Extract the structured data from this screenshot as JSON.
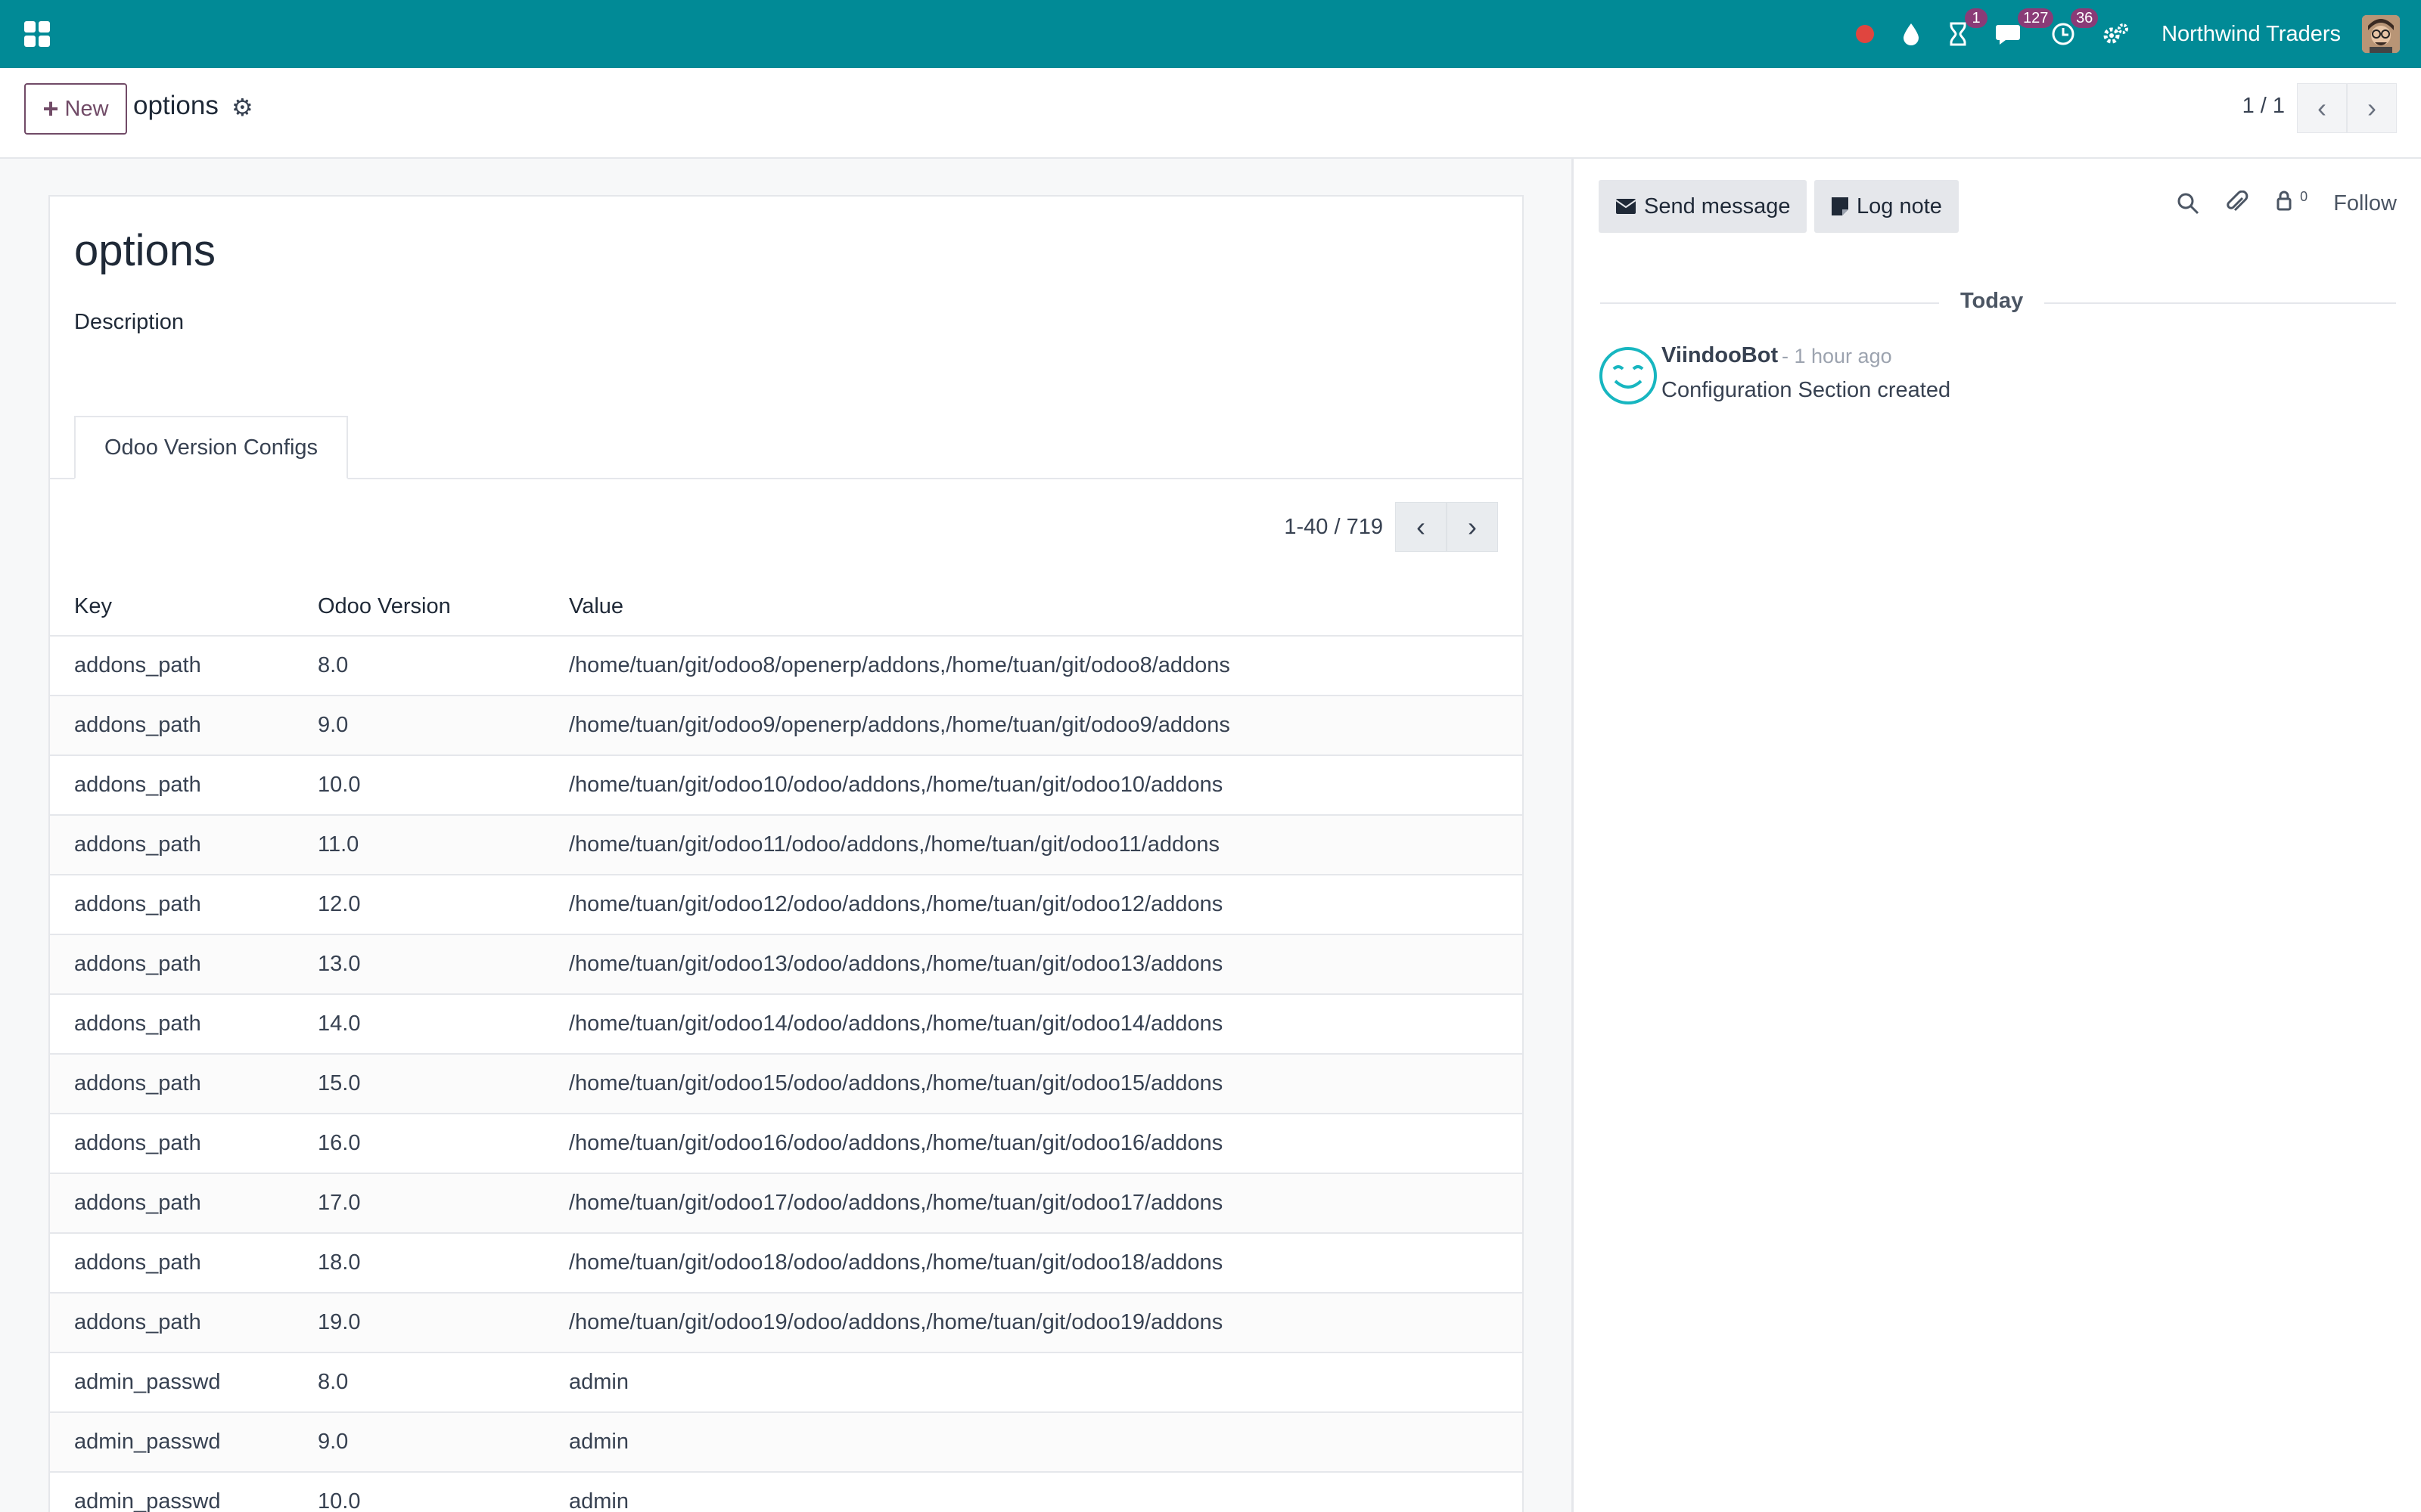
{
  "navbar": {
    "notif_counts": {
      "activities": "1",
      "messages": "127",
      "clock": "36"
    },
    "company": "Northwind Traders"
  },
  "control": {
    "new_label": "New",
    "record_title": "options",
    "pager": "1 / 1"
  },
  "form": {
    "title": "options",
    "description_label": "Description",
    "tab_label": "Odoo Version Configs",
    "list_pager": "1-40 / 719",
    "columns": [
      "Key",
      "Odoo Version",
      "Value"
    ],
    "rows": [
      {
        "key": "addons_path",
        "version": "8.0",
        "value": "/home/tuan/git/odoo8/openerp/addons,/home/tuan/git/odoo8/addons"
      },
      {
        "key": "addons_path",
        "version": "9.0",
        "value": "/home/tuan/git/odoo9/openerp/addons,/home/tuan/git/odoo9/addons"
      },
      {
        "key": "addons_path",
        "version": "10.0",
        "value": "/home/tuan/git/odoo10/odoo/addons,/home/tuan/git/odoo10/addons"
      },
      {
        "key": "addons_path",
        "version": "11.0",
        "value": "/home/tuan/git/odoo11/odoo/addons,/home/tuan/git/odoo11/addons"
      },
      {
        "key": "addons_path",
        "version": "12.0",
        "value": "/home/tuan/git/odoo12/odoo/addons,/home/tuan/git/odoo12/addons"
      },
      {
        "key": "addons_path",
        "version": "13.0",
        "value": "/home/tuan/git/odoo13/odoo/addons,/home/tuan/git/odoo13/addons"
      },
      {
        "key": "addons_path",
        "version": "14.0",
        "value": "/home/tuan/git/odoo14/odoo/addons,/home/tuan/git/odoo14/addons"
      },
      {
        "key": "addons_path",
        "version": "15.0",
        "value": "/home/tuan/git/odoo15/odoo/addons,/home/tuan/git/odoo15/addons"
      },
      {
        "key": "addons_path",
        "version": "16.0",
        "value": "/home/tuan/git/odoo16/odoo/addons,/home/tuan/git/odoo16/addons"
      },
      {
        "key": "addons_path",
        "version": "17.0",
        "value": "/home/tuan/git/odoo17/odoo/addons,/home/tuan/git/odoo17/addons"
      },
      {
        "key": "addons_path",
        "version": "18.0",
        "value": "/home/tuan/git/odoo18/odoo/addons,/home/tuan/git/odoo18/addons"
      },
      {
        "key": "addons_path",
        "version": "19.0",
        "value": "/home/tuan/git/odoo19/odoo/addons,/home/tuan/git/odoo19/addons"
      },
      {
        "key": "admin_passwd",
        "version": "8.0",
        "value": "admin"
      },
      {
        "key": "admin_passwd",
        "version": "9.0",
        "value": "admin"
      },
      {
        "key": "admin_passwd",
        "version": "10.0",
        "value": "admin"
      }
    ]
  },
  "chatter": {
    "send_message": "Send message",
    "log_note": "Log note",
    "followers_count": "0",
    "follow": "Follow",
    "date_separator": "Today",
    "message": {
      "author": "ViindooBot",
      "time": "- 1 hour ago",
      "body": "Configuration Section created"
    }
  }
}
